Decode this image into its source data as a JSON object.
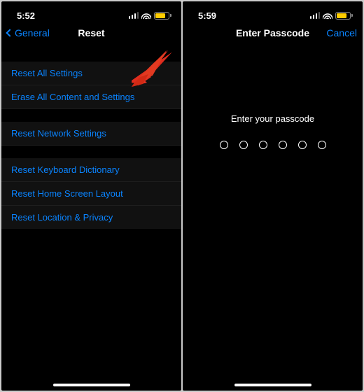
{
  "left": {
    "status": {
      "time": "5:52",
      "battery_pct": 80,
      "battery_color": "#ffcc00"
    },
    "nav": {
      "back_label": "General",
      "title": "Reset"
    },
    "sections": {
      "s1": [
        {
          "label": "Reset All Settings"
        },
        {
          "label": "Erase All Content and Settings"
        }
      ],
      "s2": [
        {
          "label": "Reset Network Settings"
        }
      ],
      "s3": [
        {
          "label": "Reset Keyboard Dictionary"
        },
        {
          "label": "Reset Home Screen Layout"
        },
        {
          "label": "Reset Location & Privacy"
        }
      ]
    },
    "annotation": {
      "type": "arrow",
      "color": "#e53223",
      "target_label": "Erase All Content and Settings"
    }
  },
  "right": {
    "status": {
      "time": "5:59",
      "battery_pct": 80,
      "battery_color": "#ffcc00"
    },
    "nav": {
      "title": "Enter Passcode",
      "right_label": "Cancel"
    },
    "prompt": "Enter your passcode",
    "passcode_length": 6,
    "passcode_filled": 0
  },
  "colors": {
    "link": "#0a84ff",
    "bg_row": "#111111",
    "bg": "#000000",
    "text": "#ffffff"
  }
}
